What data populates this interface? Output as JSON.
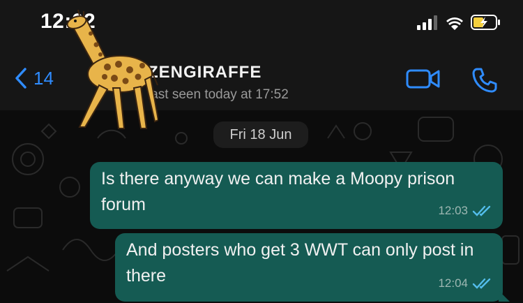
{
  "status_bar": {
    "time": "12:02",
    "signal_icon": "signal-icon",
    "wifi_icon": "wifi-icon",
    "battery_icon": "battery-charging-icon"
  },
  "header": {
    "back_count": "14",
    "contact_name": "ZENGIRAFFE",
    "last_seen": "last seen today at 17:52",
    "video_call_icon": "video-call-icon",
    "voice_call_icon": "phone-icon",
    "avatar_sticker": "giraffe-sticker"
  },
  "chat": {
    "date_label": "Fri 18 Jun",
    "messages": [
      {
        "text": "Is there anyway we can make a Moopy prison forum",
        "time": "12:03",
        "status": "read"
      },
      {
        "text": "And posters who get 3 WWT can only post in there",
        "time": "12:04",
        "status": "read"
      }
    ]
  },
  "colors": {
    "accent": "#2f8cff",
    "bubble_out": "#155b53",
    "bar_bg": "#161616",
    "chat_bg": "#0c0c0c",
    "read_ticks": "#53bdeb"
  }
}
